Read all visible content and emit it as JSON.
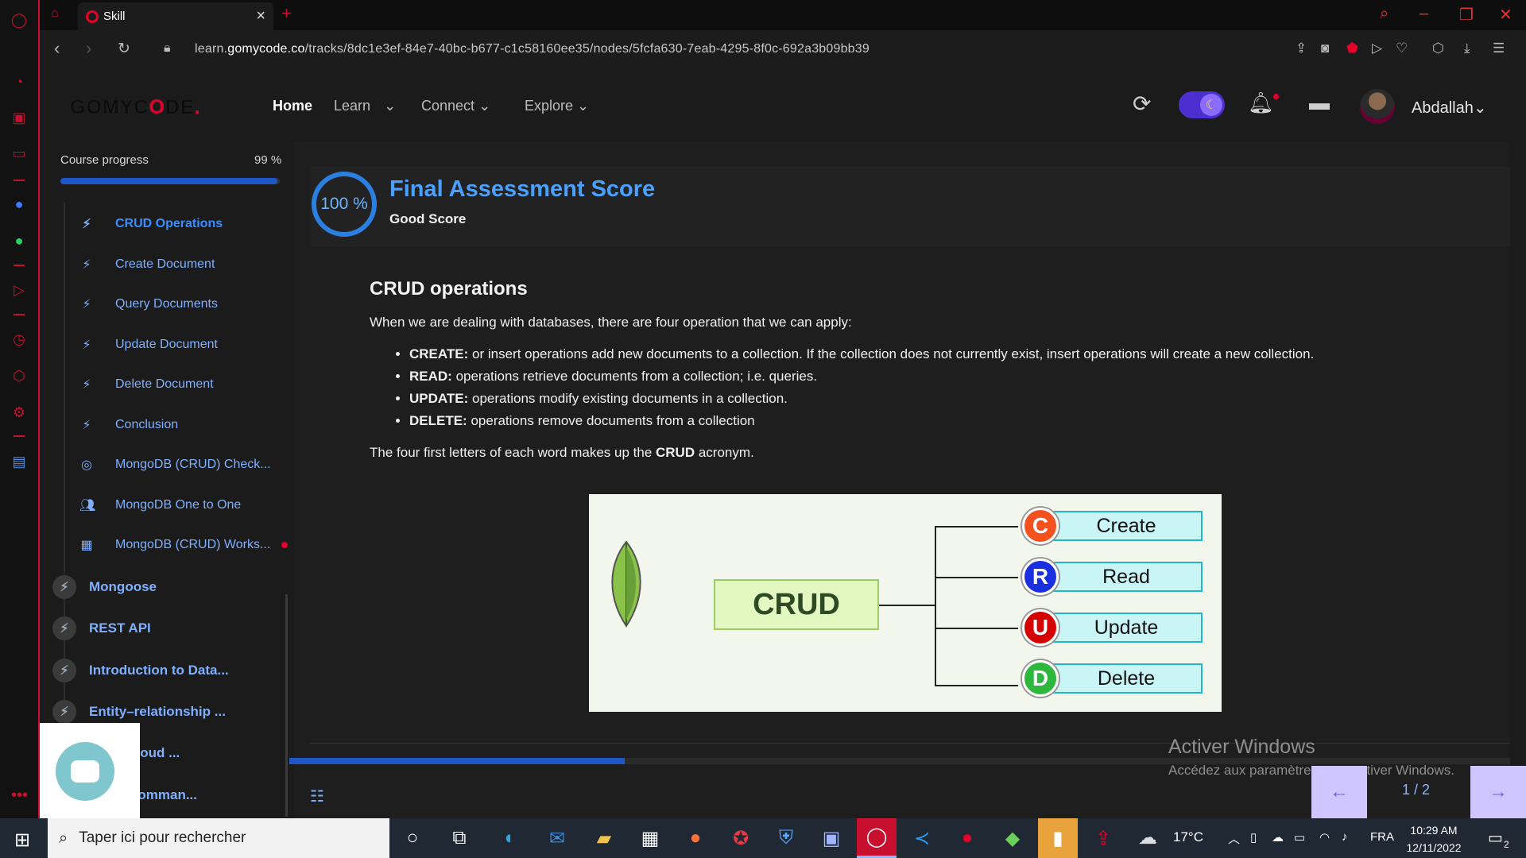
{
  "browser": {
    "tab_title": "Skill",
    "url_prefix": "learn.",
    "url_domain": "gomycode.co",
    "url_path": "/tracks/8dc1e3ef-84e7-40bc-b677-c1c58160ee35/nodes/5fcfa630-7eab-4295-8f0c-692a3b09bb39"
  },
  "header": {
    "logo": "GOMYCODE",
    "nav": [
      {
        "label": "Home"
      },
      {
        "label": "Learn"
      },
      {
        "label": "Connect"
      },
      {
        "label": "Explore"
      }
    ],
    "username": "Abdallah"
  },
  "sidebar": {
    "progress_label": "Course progress",
    "progress_value": "99 %",
    "progress_fraction": 0.99,
    "lessons": [
      {
        "label": "CRUD Operations",
        "icon": "bolt-icon"
      },
      {
        "label": "Create Document",
        "icon": "bolt-icon"
      },
      {
        "label": "Query Documents",
        "icon": "bolt-icon"
      },
      {
        "label": "Update Document",
        "icon": "bolt-icon"
      },
      {
        "label": "Delete Document",
        "icon": "bolt-icon"
      },
      {
        "label": "Conclusion",
        "icon": "bolt-icon"
      },
      {
        "label": "MongoDB (CRUD) Check...",
        "icon": "target-icon"
      },
      {
        "label": "MongoDB One to One",
        "icon": "people-icon"
      },
      {
        "label": "MongoDB (CRUD) Works...",
        "icon": "workshop-icon"
      }
    ],
    "modules": [
      {
        "label": "Mongoose"
      },
      {
        "label": "REST API"
      },
      {
        "label": "Introduction to Data..."
      },
      {
        "label": "Entity–relationship ..."
      },
      {
        "label": "ion & Cloud ..."
      },
      {
        "label": "Flow (Comman..."
      }
    ]
  },
  "score": {
    "percent": "100 %",
    "title": "Final Assessment Score",
    "subtitle": "Good Score"
  },
  "article": {
    "heading": "CRUD operations",
    "intro": "When we are dealing with databases, there are four operation that we can apply:",
    "items": [
      {
        "term": "CREATE:",
        "text": " or insert operations add new documents to a collection. If the collection does not currently exist, insert operations will create a new collection."
      },
      {
        "term": "READ:",
        "text": " operations retrieve documents from a collection; i.e. queries."
      },
      {
        "term": "UPDATE:",
        "text": " operations modify existing documents in a collection."
      },
      {
        "term": "DELETE:",
        "text": " operations remove documents from a collection"
      }
    ],
    "outro_start": "The four first letters of each word makes up the ",
    "outro_bold": "CRUD",
    "outro_end": " acronym."
  },
  "diagram": {
    "center": "CRUD",
    "ops": [
      {
        "letter": "C",
        "label": "Create",
        "color": "#f4511e"
      },
      {
        "letter": "R",
        "label": "Read",
        "color": "#1a2fe0"
      },
      {
        "letter": "U",
        "label": "Update",
        "color": "#d50000"
      },
      {
        "letter": "D",
        "label": "Delete",
        "color": "#2db83d"
      }
    ]
  },
  "content_progress_fraction": 0.275,
  "pager": {
    "text": "1 / 2"
  },
  "watermark": {
    "title": "Activer Windows",
    "subtitle": "Accédez aux paramètres pour activer Windows."
  },
  "taskbar": {
    "search_placeholder": "Taper ici pour rechercher",
    "weather": "17°C",
    "language": "FRA",
    "time": "10:29 AM",
    "date": "12/11/2022",
    "notifications": "2"
  },
  "colors": {
    "accent": "#1e58c8",
    "brand_red": "#e4002b",
    "link_blue": "#7fb0ff"
  }
}
